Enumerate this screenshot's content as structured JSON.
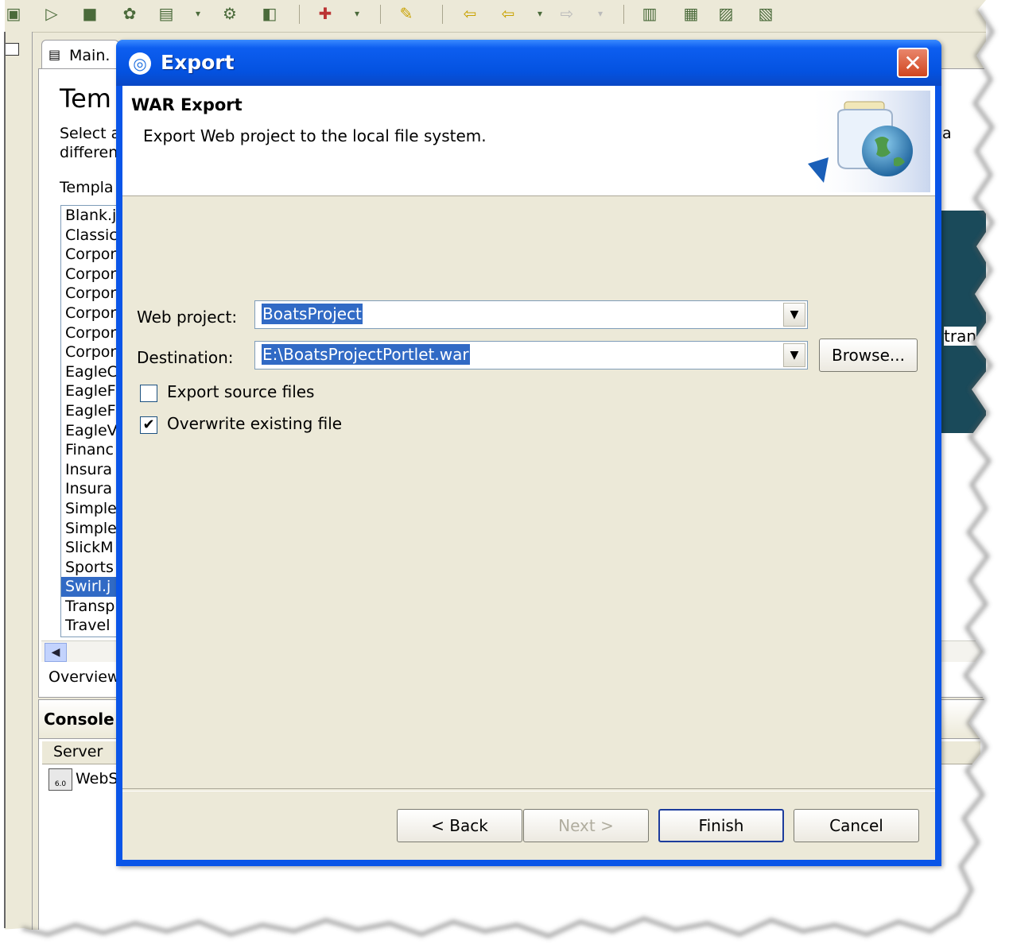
{
  "background": {
    "editor_tab_label": "Main.",
    "heading_fragment": "Tem",
    "desc_line1": "Select a",
    "desc_line2": "differen",
    "templates_label": "Templa",
    "templates": [
      "Blank.j",
      "Classic",
      "Corpor",
      "Corpor",
      "Corpor",
      "Corpor",
      "Corpor",
      "Corpor",
      "EagleC",
      "EagleF",
      "EagleF",
      "EagleV",
      "Financ",
      "Insura",
      "Insura",
      "Simple",
      "Simple",
      "SlickM",
      "Sports",
      "Swirl.j",
      "Transp",
      "Travel"
    ],
    "selected_template_index": 19,
    "overview_tab": "Overview",
    "console_title": "Console",
    "server_header": "Server",
    "server_row": "WebS",
    "server_version_badge": "6.0",
    "right_fragment": "tran",
    "right_fragment2": "a"
  },
  "dialog": {
    "title": "Export",
    "header_title": "WAR Export",
    "header_description": "Export Web project to the local file system.",
    "web_project_label": "Web project:",
    "web_project_value": "BoatsProject",
    "destination_label": "Destination:",
    "destination_value": "E:\\BoatsProjectPortlet.war",
    "browse_label": "Browse...",
    "export_source_label": "Export source files",
    "export_source_checked": false,
    "overwrite_label": "Overwrite existing file",
    "overwrite_checked": true,
    "back_label": "< Back",
    "next_label": "Next >",
    "finish_label": "Finish",
    "cancel_label": "Cancel"
  },
  "colors": {
    "title_bar": "#0a55e8",
    "selection": "#316ac5",
    "dialog_face": "#ece9d8",
    "close_button": "#d0451f"
  }
}
